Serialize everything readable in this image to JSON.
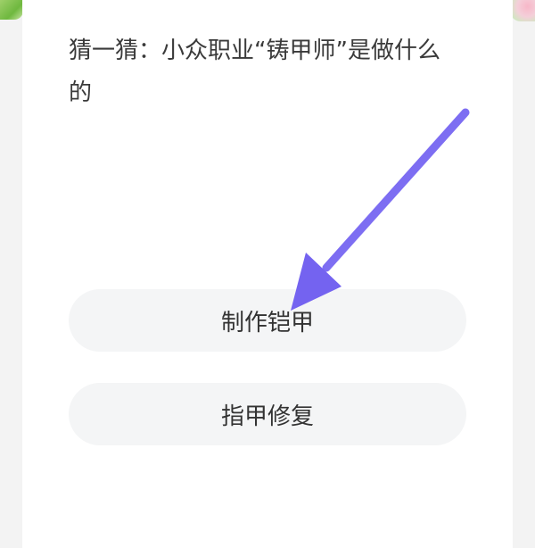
{
  "question": {
    "text": "猜一猜：小众职业“铸甲师”是做什么的"
  },
  "options": [
    {
      "label": "制作铠甲"
    },
    {
      "label": "指甲修复"
    }
  ],
  "annotation": {
    "arrow_color": "#7c6cf0",
    "points_to": "制作铠甲"
  }
}
